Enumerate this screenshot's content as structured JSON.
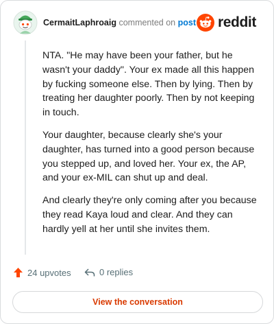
{
  "header": {
    "username": "CermaitLaphroaig",
    "action_text": "commented on",
    "target_text": "post",
    "brand": "reddit"
  },
  "comment": {
    "paragraphs": [
      "NTA. \"He may have been your father, but he wasn't your daddy\". Your ex made all this happen by fucking someone else. Then by lying. Then by treating her daughter poorly. Then by not keeping in touch.",
      "Your daughter, because clearly she's your daughter, has turned into a good person because you stepped up, and loved her. Your ex, the AP, and your ex-MIL can shut up and deal.",
      "And clearly they're only coming after you because they read Kaya loud and clear. And they can hardly yell at her until she invites them."
    ]
  },
  "stats": {
    "upvotes_label": "24 upvotes",
    "replies_label": "0 replies"
  },
  "actions": {
    "view_conversation_label": "View the conversation"
  },
  "colors": {
    "brand_orange": "#ff4500",
    "link_blue": "#0079d3",
    "button_text": "#d93a00",
    "muted_text": "#576f76"
  },
  "icons": {
    "avatar": "snoo-avatar-icon",
    "brand": "reddit-alien-icon",
    "upvote": "upvote-arrow-icon",
    "reply": "reply-arrow-icon"
  }
}
